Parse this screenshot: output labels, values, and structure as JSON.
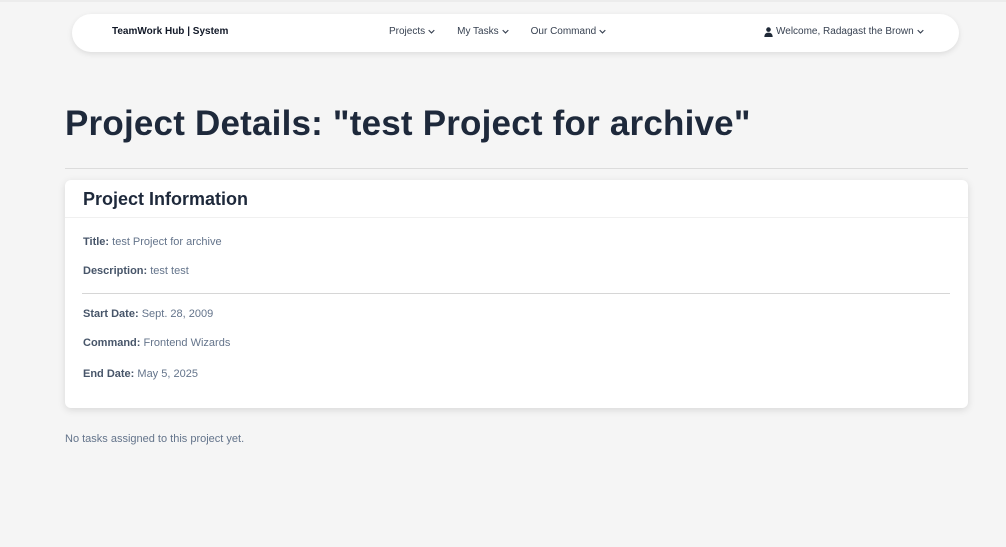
{
  "navbar": {
    "brand": "TeamWork Hub | System",
    "links": [
      {
        "label": "Projects",
        "icon": "chevron-down-icon"
      },
      {
        "label": "My Tasks",
        "icon": "chevron-down-icon"
      },
      {
        "label": "Our Command",
        "icon": "chevron-down-icon"
      }
    ],
    "user": {
      "label": "Welcome, Radagast the Brown",
      "icon": "user-icon"
    }
  },
  "page": {
    "title": "Project Details: \"test Project for archive\""
  },
  "card": {
    "header": "Project Information",
    "fields": {
      "title": {
        "label": "Title:",
        "value": "test Project for archive"
      },
      "description": {
        "label": "Description:",
        "value": "test test"
      },
      "start_date": {
        "label": "Start Date:",
        "value": "Sept. 28, 2009"
      },
      "command": {
        "label": "Command:",
        "value": "Frontend Wizards"
      },
      "end_date": {
        "label": "End Date:",
        "value": "May 5, 2025"
      }
    }
  },
  "tasks": {
    "empty_message": "No tasks assigned to this project yet."
  },
  "colors": {
    "background": "#f5f5f5",
    "heading": "#1e293b",
    "muted_text": "#64748b"
  }
}
